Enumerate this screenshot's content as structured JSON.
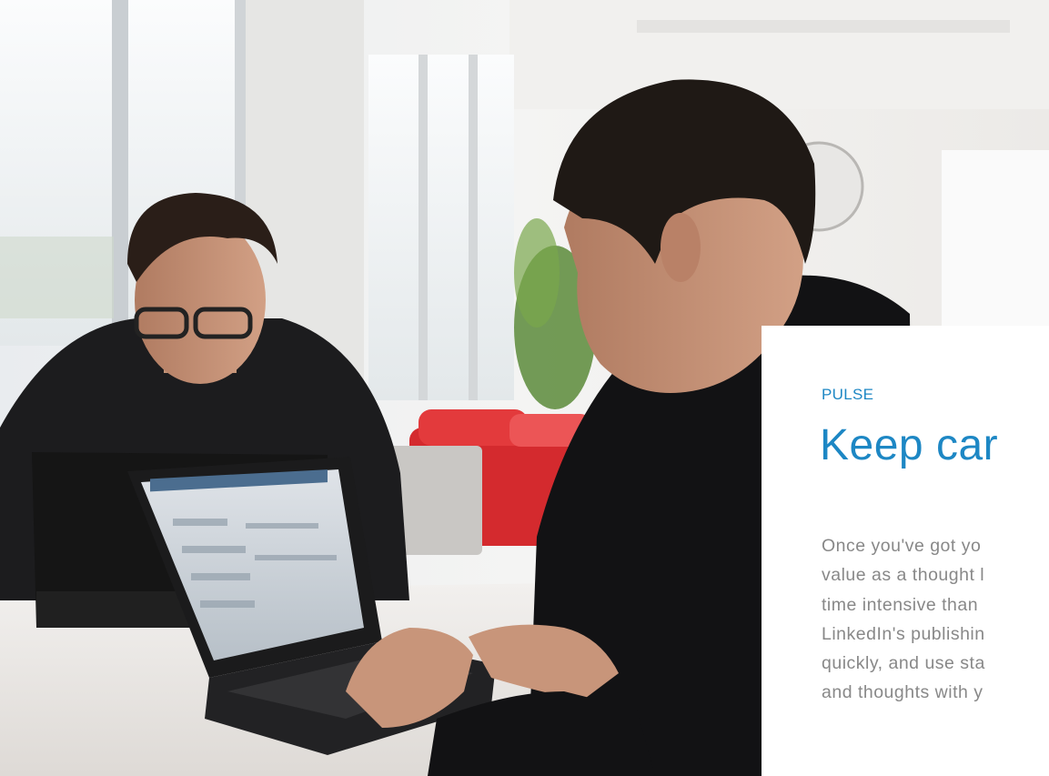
{
  "scene": {
    "description_icon": "office-photo"
  },
  "card": {
    "eyebrow": "PULSE",
    "headline": "Keep car",
    "body_lines": [
      "Once you've got yo",
      "value as a thought l",
      "time intensive than",
      "LinkedIn's publishin",
      "quickly, and use sta",
      "and thoughts with y"
    ]
  },
  "colors": {
    "accent": "#1d87c4",
    "body_text": "#888888",
    "card_bg": "#ffffff"
  }
}
